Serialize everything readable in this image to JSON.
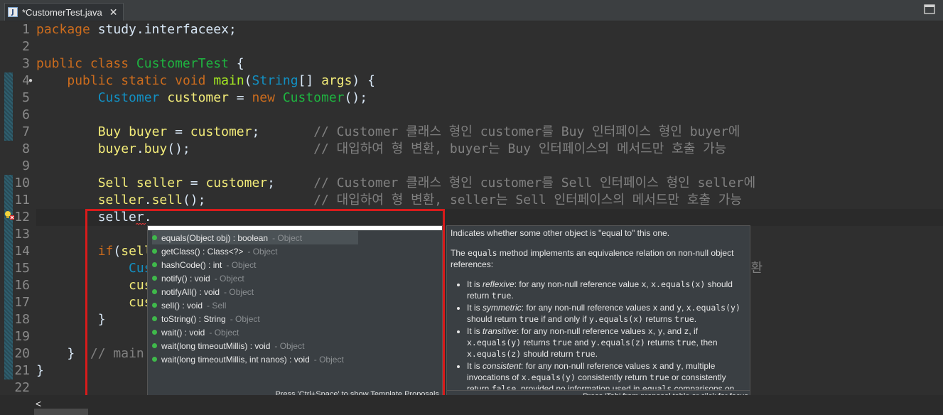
{
  "tab": {
    "title": "*CustomerTest.java",
    "icon": "java-file-icon",
    "close": "✕"
  },
  "lines": [
    "1",
    "2",
    "3",
    "4",
    "5",
    "6",
    "7",
    "8",
    "9",
    "10",
    "11",
    "12",
    "13",
    "14",
    "15",
    "16",
    "17",
    "18",
    "19",
    "20",
    "21",
    "22"
  ],
  "code": {
    "l1_kw": "package",
    "l1_rest": " study.interfaceex;",
    "l3_kw1": "public",
    "l3_kw2": "class",
    "l3_cls": "CustomerTest",
    "l3_rest": " {",
    "l4_kw1": "public",
    "l4_kw2": "static",
    "l4_kw3": "void",
    "l4_fn": "main",
    "l4_ty": "String",
    "l4_var": "args",
    "l4_rest": ") {",
    "l5_cls1": "Customer",
    "l5_var": "customer",
    "l5_kw": "new",
    "l5_cls2": "Customer",
    "l5_rest": "();",
    "l7_cls": "Buy",
    "l7_var": "buyer",
    "l7_var2": "customer",
    "l7_cm": "// Customer 클래스 형인 customer를 Buy 인터페이스 형인 buyer에",
    "l8_var": "buyer",
    "l8_fn": "buy",
    "l8_cm": "// 대입하여 형 변환, buyer는 Buy 인터페이스의 메서드만 호출 가능",
    "l10_cls": "Sell",
    "l10_var": "seller",
    "l10_var2": "customer",
    "l10_cm": "// Customer 클래스 형인 customer를 Sell 인터페이스 형인 seller에",
    "l11_var": "seller",
    "l11_fn": "sell",
    "l11_cm": "// 대입하여 형 변환, seller는 Sell 인터페이스의 메서드만 호출 가능",
    "l12_text": "seller.",
    "l14_kw": "if",
    "l14_var": "selle",
    "l15_cls": "Cust",
    "l15_tail": "변환",
    "l16_var": "cust",
    "l17_var": "cust",
    "l18_text": "}",
    "l20_brace": "}",
    "l20_cm": "// main",
    "l21_text": "}"
  },
  "proposals": [
    {
      "sig": "equals(Object obj) : boolean",
      "owner": "- Object"
    },
    {
      "sig": "getClass() : Class<?>",
      "owner": "- Object"
    },
    {
      "sig": "hashCode() : int",
      "owner": "- Object"
    },
    {
      "sig": "notify() : void",
      "owner": "- Object"
    },
    {
      "sig": "notifyAll() : void",
      "owner": "- Object"
    },
    {
      "sig": "sell() : void",
      "owner": "- Sell"
    },
    {
      "sig": "toString() : String",
      "owner": "- Object"
    },
    {
      "sig": "wait() : void",
      "owner": "- Object"
    },
    {
      "sig": "wait(long timeoutMillis) : void",
      "owner": "- Object"
    },
    {
      "sig": "wait(long timeoutMillis, int nanos) : void",
      "owner": "- Object"
    }
  ],
  "proposal_footer": "Press 'Ctrl+Space' to show Template Proposals",
  "doc": {
    "intro": "Indicates whether some other object is \"equal to\" this one.",
    "p2a": "The ",
    "p2code": "equals",
    "p2b": " method implements an equivalence relation on non-null object references:",
    "b1": {
      "a": "It is ",
      "em": "reflexive",
      "b": ": for any non-null reference value ",
      "c1": "x",
      "c": ", ",
      "c2": "x.equals(x)",
      "d": " should return ",
      "c3": "true",
      "e": "."
    },
    "b2": {
      "a": "It is ",
      "em": "symmetric",
      "b": ": for any non-null reference values ",
      "c1": "x",
      "c": " and ",
      "c2": "y",
      "d": ", ",
      "c3": "x.equals(y)",
      "e": " should return ",
      "c4": "true",
      "f": " if and only if ",
      "c5": "y.equals(x)",
      "g": " returns ",
      "c6": "true",
      "h": "."
    },
    "b3": {
      "a": "It is ",
      "em": "transitive",
      "b": ": for any non-null reference values ",
      "c1": "x",
      "c": ", ",
      "c2": "y",
      "d": ", and ",
      "c3": "z",
      "e": ", if ",
      "c4": "x.equals(y)",
      "f": " returns ",
      "c5": "true",
      "g": " and ",
      "c6": "y.equals(z)",
      "h": " returns ",
      "c7": "true",
      "i": ", then ",
      "c8": "x.equals(z)",
      "j": " should return ",
      "c9": "true",
      "k": "."
    },
    "b4": {
      "a": "It is ",
      "em": "consistent",
      "b": ": for any non-null reference values ",
      "c1": "x",
      "c": " and ",
      "c2": "y",
      "d": ", multiple invocations of ",
      "c3": "x.equals(y)",
      "e": " consistently return ",
      "c4": "true",
      "f": " or consistently return ",
      "c5": "false",
      "g": ", provided no information used in ",
      "c6": "equals",
      "h": " comparisons on"
    },
    "footer": "Press 'Tab' from proposal table or click for focus"
  },
  "colors": {
    "error_highlight": "#d81b1b",
    "keyword": "#cc6c1d",
    "class": "#1eb540",
    "comment": "#808080"
  }
}
